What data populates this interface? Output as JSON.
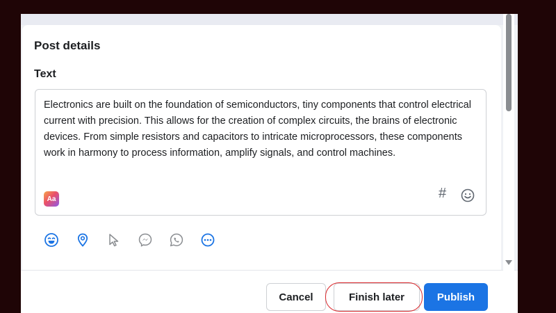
{
  "post_details": {
    "title": "Post details",
    "text_label": "Text",
    "text_value": "Electronics are built on the foundation of semiconductors, tiny components that control electrical current with precision. This allows for the creation of complex circuits, the brains of electronic devices. From simple resistors and capacitors to intricate microprocessors, these components work in harmony to process information, amplify signals, and control machines.",
    "format_icon_label": "Aa",
    "hashtag_symbol": "#"
  },
  "toolbar": {
    "icons": [
      "feeling-emoji-icon",
      "location-pin-icon",
      "cursor-icon",
      "messenger-icon",
      "whatsapp-icon",
      "more-options-icon"
    ]
  },
  "footer": {
    "cancel_label": "Cancel",
    "finish_later_label": "Finish later",
    "publish_label": "Publish"
  },
  "colors": {
    "accent": "#1b74e4",
    "icon_blue": "#1b74e4",
    "annotation_red": "#d9262a",
    "background_dark": "#1f0506"
  }
}
